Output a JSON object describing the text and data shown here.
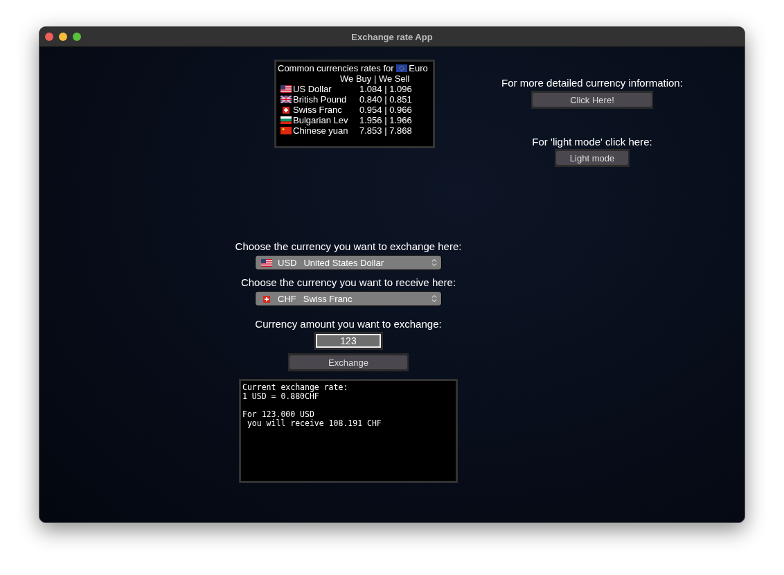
{
  "window": {
    "title": "Exchange rate App"
  },
  "rates": {
    "heading": "Common currencies rates for",
    "base": {
      "kind": "eu",
      "name": "Euro"
    },
    "columns": "We Buy | We Sell",
    "rows": [
      {
        "kind": "us",
        "name": "US Dollar",
        "values": "1.084 | 1.096"
      },
      {
        "kind": "gb",
        "name": "British Pound",
        "values": "0.840 | 0.851"
      },
      {
        "kind": "ch",
        "name": "Swiss Franc",
        "values": "0.954 | 0.966"
      },
      {
        "kind": "bg",
        "name": "Bulgarian Lev",
        "values": "1.956 | 1.966"
      },
      {
        "kind": "cn",
        "name": "Chinese yuan",
        "values": "7.853 | 7.868"
      }
    ]
  },
  "info": {
    "label": "For more detailed currency information:",
    "button": "Click Here!"
  },
  "theme": {
    "label": "For 'light mode' click here:",
    "button": "Light mode"
  },
  "from": {
    "label": "Choose the currency you want to exchange here:",
    "kind": "us",
    "code": "USD",
    "name": "United States Dollar"
  },
  "to": {
    "label": "Choose the currency you want to receive here:",
    "kind": "ch",
    "code": "CHF",
    "name": "Swiss Franc"
  },
  "amount": {
    "label": "Currency amount you want to exchange:",
    "value": "123"
  },
  "exchange_button": "Exchange",
  "output": "Current exchange rate:\n1 USD = 0.880CHF\n\nFor 123.000 USD\n you will receive 108.191 CHF"
}
